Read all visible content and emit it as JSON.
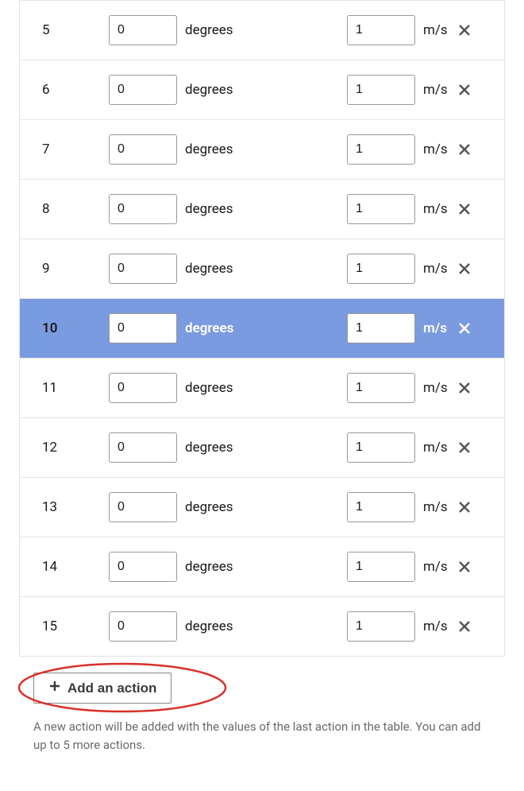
{
  "rows": [
    {
      "index": "5",
      "steering": "0",
      "steering_unit": "degrees",
      "speed": "1",
      "speed_unit": "m/s",
      "selected": false
    },
    {
      "index": "6",
      "steering": "0",
      "steering_unit": "degrees",
      "speed": "1",
      "speed_unit": "m/s",
      "selected": false
    },
    {
      "index": "7",
      "steering": "0",
      "steering_unit": "degrees",
      "speed": "1",
      "speed_unit": "m/s",
      "selected": false
    },
    {
      "index": "8",
      "steering": "0",
      "steering_unit": "degrees",
      "speed": "1",
      "speed_unit": "m/s",
      "selected": false
    },
    {
      "index": "9",
      "steering": "0",
      "steering_unit": "degrees",
      "speed": "1",
      "speed_unit": "m/s",
      "selected": false
    },
    {
      "index": "10",
      "steering": "0",
      "steering_unit": "degrees",
      "speed": "1",
      "speed_unit": "m/s",
      "selected": true
    },
    {
      "index": "11",
      "steering": "0",
      "steering_unit": "degrees",
      "speed": "1",
      "speed_unit": "m/s",
      "selected": false
    },
    {
      "index": "12",
      "steering": "0",
      "steering_unit": "degrees",
      "speed": "1",
      "speed_unit": "m/s",
      "selected": false
    },
    {
      "index": "13",
      "steering": "0",
      "steering_unit": "degrees",
      "speed": "1",
      "speed_unit": "m/s",
      "selected": false
    },
    {
      "index": "14",
      "steering": "0",
      "steering_unit": "degrees",
      "speed": "1",
      "speed_unit": "m/s",
      "selected": false
    },
    {
      "index": "15",
      "steering": "0",
      "steering_unit": "degrees",
      "speed": "1",
      "speed_unit": "m/s",
      "selected": false
    }
  ],
  "footer": {
    "add_label": "Add an action",
    "hint": "A new action will be added with the values of the last action in the table. You can add up to 5 more actions."
  },
  "colors": {
    "selected_bg": "#7b9be0",
    "annotation": "#d8302a"
  }
}
